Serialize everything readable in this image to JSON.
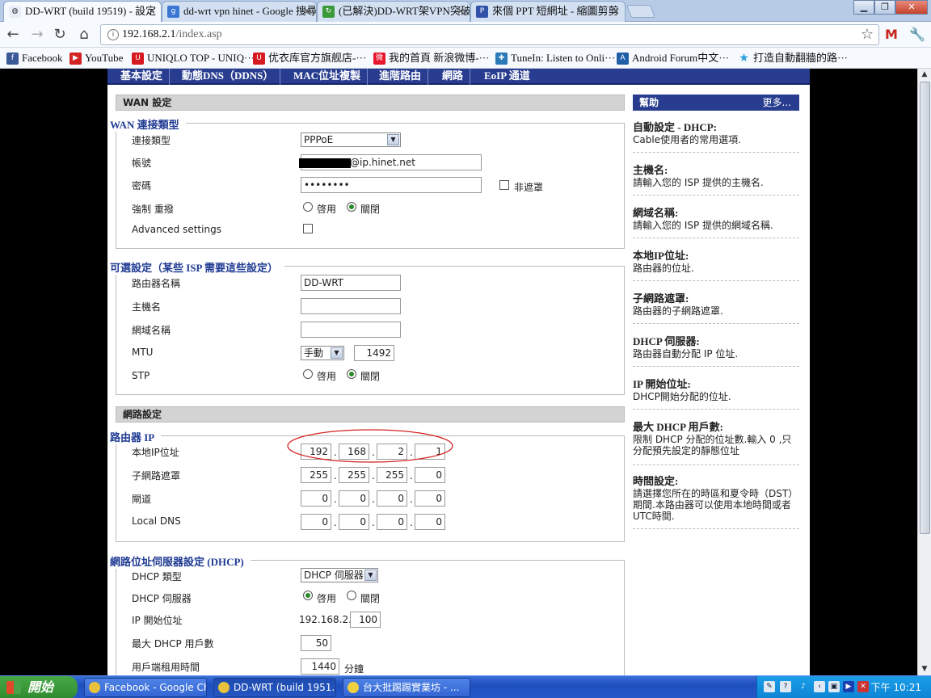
{
  "browser": {
    "tabs": [
      {
        "title": "DD-WRT (build 19519) - 設定",
        "icon": "ddwrt-favicon",
        "active": true
      },
      {
        "title": "dd-wrt vpn hinet - Google 搜尋",
        "icon": "google-favicon",
        "active": false
      },
      {
        "title": "(已解決)DD-WRT架VPN突破",
        "icon": "refresh-favicon",
        "active": false
      },
      {
        "title": "來個 PPT 短網址 - 縮圖剪剪",
        "icon": "ppt-favicon",
        "active": false
      }
    ],
    "url_host": "192.168.2.1",
    "url_path": "/index.asp",
    "bookmarks": [
      {
        "label": "Facebook",
        "icon": "facebook-icon",
        "color": "#3b5998"
      },
      {
        "label": "YouTube",
        "icon": "youtube-icon",
        "color": "#d32323"
      },
      {
        "label": "UNIQLO TOP - UNIQ···",
        "icon": "uniqlo-icon",
        "color": "#d71920"
      },
      {
        "label": "优衣库官方旗舰店-···",
        "icon": "uniqlo-icon",
        "color": "#d71920"
      },
      {
        "label": "我的首頁 新浪微博-···",
        "icon": "weibo-icon",
        "color": "#e6162d"
      },
      {
        "label": "TuneIn: Listen to Onli···",
        "icon": "tunein-icon",
        "color": "#2a7ab8"
      },
      {
        "label": "Android Forum中文···",
        "icon": "android-forum-icon",
        "color": "#1f5fa8"
      },
      {
        "label": "打造自動翻牆的路···",
        "icon": "star-icon",
        "color": "#2a9ad8"
      }
    ]
  },
  "router": {
    "menu": [
      "基本設定",
      "動態DNS（DDNS）",
      "MAC位址複製",
      "進階路由",
      "網路",
      "EoIP 通道"
    ],
    "wan": {
      "section_title": "WAN 設定",
      "legend": "WAN 連接類型",
      "conn_type_label": "連接類型",
      "conn_type_value": "PPPoE",
      "username_label": "帳號",
      "username_value": "@ip.hinet.net",
      "password_label": "密碼",
      "password_value": "••••••••",
      "unmask_label": "非遮罩",
      "reconnect_label": "強制 重撥",
      "enable_label": "啓用",
      "disable_label": "關閉",
      "advanced_label": "Advanced settings"
    },
    "optional": {
      "legend": "可選設定（某些 ISP 需要這些設定）",
      "router_name_label": "路由器名稱",
      "router_name_value": "DD-WRT",
      "hostname_label": "主機名",
      "hostname_value": "",
      "domain_label": "網域名稱",
      "domain_value": "",
      "mtu_label": "MTU",
      "mtu_mode": "手動",
      "mtu_value": "1492",
      "stp_label": "STP",
      "enable_label": "啓用",
      "disable_label": "關閉"
    },
    "network": {
      "section_title": "網路設定",
      "legend": "路由器 IP",
      "local_ip_label": "本地IP位址",
      "local_ip": [
        "192",
        "168",
        "2",
        "1"
      ],
      "subnet_label": "子網路遮罩",
      "subnet": [
        "255",
        "255",
        "255",
        "0"
      ],
      "gateway_label": "閘道",
      "gateway": [
        "0",
        "0",
        "0",
        "0"
      ],
      "dns_label": "Local DNS",
      "dns": [
        "0",
        "0",
        "0",
        "0"
      ]
    },
    "dhcp": {
      "legend": "網路位址伺服器設定 (DHCP)",
      "type_label": "DHCP 類型",
      "type_value": "DHCP 伺服器",
      "server_label": "DHCP 伺服器",
      "enable_label": "啓用",
      "disable_label": "關閉",
      "start_label": "IP 開始位址",
      "start_prefix": "192.168.2.",
      "start_value": "100",
      "max_users_label": "最大 DHCP 用戶數",
      "max_users_value": "50",
      "lease_label": "用戶端租用時間",
      "lease_value": "1440",
      "lease_unit": "分鐘"
    },
    "help": {
      "title": "幫助",
      "more": "更多...",
      "items": [
        {
          "t": "自動設定 - DHCP:",
          "d": "Cable使用者的常用選項."
        },
        {
          "t": "主機名:",
          "d": "請輸入您的 ISP 提供的主機名."
        },
        {
          "t": "網域名稱:",
          "d": "請輸入您的 ISP 提供的網域名稱."
        },
        {
          "t": "本地IP位址:",
          "d": "路由器的位址."
        },
        {
          "t": "子網路遮罩:",
          "d": "路由器的子網路遮罩."
        },
        {
          "t": "DHCP 伺服器:",
          "d": "路由器自動分配 IP 位址."
        },
        {
          "t": "IP 開始位址:",
          "d": "DHCP開始分配的位址."
        },
        {
          "t": "最大 DHCP 用戶數:",
          "d": "限制 DHCP 分配的位址數.輸入 0 ,只分配預先設定的靜態位址"
        },
        {
          "t": "時間設定:",
          "d": "請選擇您所在的時區和夏令時（DST）期間.本路由器可以使用本地時間或者UTC時間."
        }
      ]
    }
  },
  "taskbar": {
    "start_label": "開始",
    "tasks": [
      "Facebook - Google Ch...",
      "DD-WRT (build 1951...",
      "台大批踢踢實業坊 - ..."
    ],
    "clock": "下午 10:21"
  }
}
